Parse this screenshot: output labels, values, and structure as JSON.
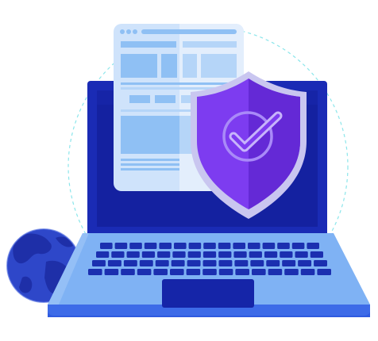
{
  "illustration": {
    "icons": [
      "globe-icon",
      "laptop-icon",
      "browser-window-icon",
      "security-shield-icon",
      "checkmark-icon"
    ],
    "colors": {
      "background": "#ffffff",
      "laptop_body": "#7FB2F4",
      "laptop_body_dark": "#2F5BE0",
      "laptop_screen_frame": "#1A2BB5",
      "laptop_screen": "#1421A0",
      "keyboard_keys": "#1B2FB0",
      "trackpad": "#1525A8",
      "browser_panel": "#CFE3FB",
      "browser_blocks": "#8FC0F4",
      "shield": "#7D3CF0",
      "shield_dark": "#6429D6",
      "shield_rim": "#C9C6F0",
      "globe": "#2E47C9",
      "globe_land": "#1E2FA8",
      "orbit_ring": "#6FE0E6"
    }
  }
}
